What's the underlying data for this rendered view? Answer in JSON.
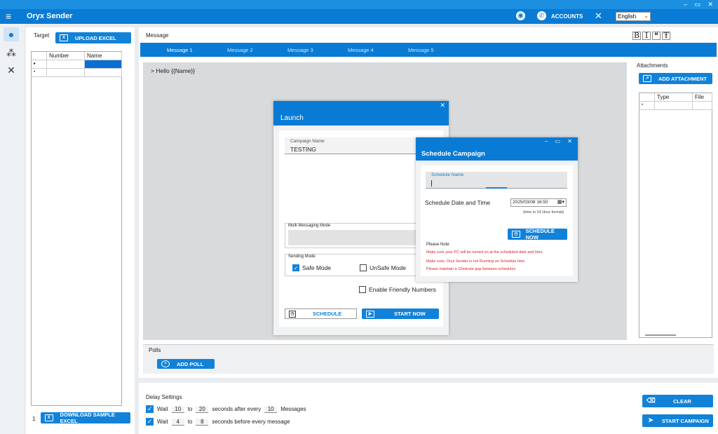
{
  "window": {
    "controls": "– ▭ ✕"
  },
  "appbar": {
    "title": "Oryx Sender",
    "menu_icon": "hamburger-icon",
    "accounts_label": "ACCOUNTS",
    "language": "English"
  },
  "target": {
    "label": "Target",
    "upload_label": "UPLOAD EXCEL",
    "columns": [
      "Number",
      "Name"
    ],
    "row_count": "1",
    "download_label": "DOWNLOAD SAMPLE EXCEL"
  },
  "message": {
    "label": "Message",
    "format_buttons": [
      "B",
      "I",
      "❝",
      "Ŧ"
    ],
    "tabs": [
      "Message 1",
      "Message 2",
      "Message 3",
      "Message 4",
      "Message 5"
    ],
    "active_tab": "Message 1",
    "body": "> Hello {{Name}}"
  },
  "attachments": {
    "label": "Attachments",
    "add_label": "ADD ATTACHMENT",
    "columns": [
      "Type",
      "File"
    ]
  },
  "polls": {
    "label": "Polls",
    "add_label": "ADD POLL"
  },
  "delay": {
    "label": "Delay Settings",
    "row1": {
      "wait": "Wait",
      "from": "10",
      "to_word": "to",
      "to": "20",
      "suffix": "seconds after every",
      "count": "10",
      "count_suffix": "Messages"
    },
    "row2": {
      "wait": "Wait",
      "from": "4",
      "to_word": "to",
      "to": "8",
      "suffix": "seconds before every message"
    },
    "clear_label": "CLEAR",
    "start_campaign_label": "START CAMPAIGN"
  },
  "launch": {
    "title": "Launch",
    "campaign_name_caption": "Campaign Name",
    "campaign_name": "TESTING",
    "multi_mode_caption": "Multi Messaging Mode",
    "sending_mode_caption": "Sending Mode",
    "safe_mode": "Safe Mode",
    "unsafe_mode": "UnSafe Mode",
    "friendly_numbers": "Enable Friendly Numbers",
    "schedule_label": "SCHEDULE",
    "start_now_label": "START NOW"
  },
  "schedule": {
    "title": "Schedule Campaign",
    "name_caption": "Schedule Name",
    "datetime_label": "Schedule Date and Time",
    "datetime_value": "2025/03/08 16:50",
    "datetime_hint": "(time in 24 Hour format)",
    "schedule_now_label": "SCHEDULE NOW",
    "note_title": "Please Note",
    "notes": [
      "Make sure your PC will be turned on at the scheduled date and time.",
      "Make sure,  Oryx Sender is not Running on Schedule time",
      "Please maintain a 10minute gap between schedules"
    ]
  },
  "colors": {
    "accent": "#0a7bd4",
    "note_red": "#e02020"
  }
}
